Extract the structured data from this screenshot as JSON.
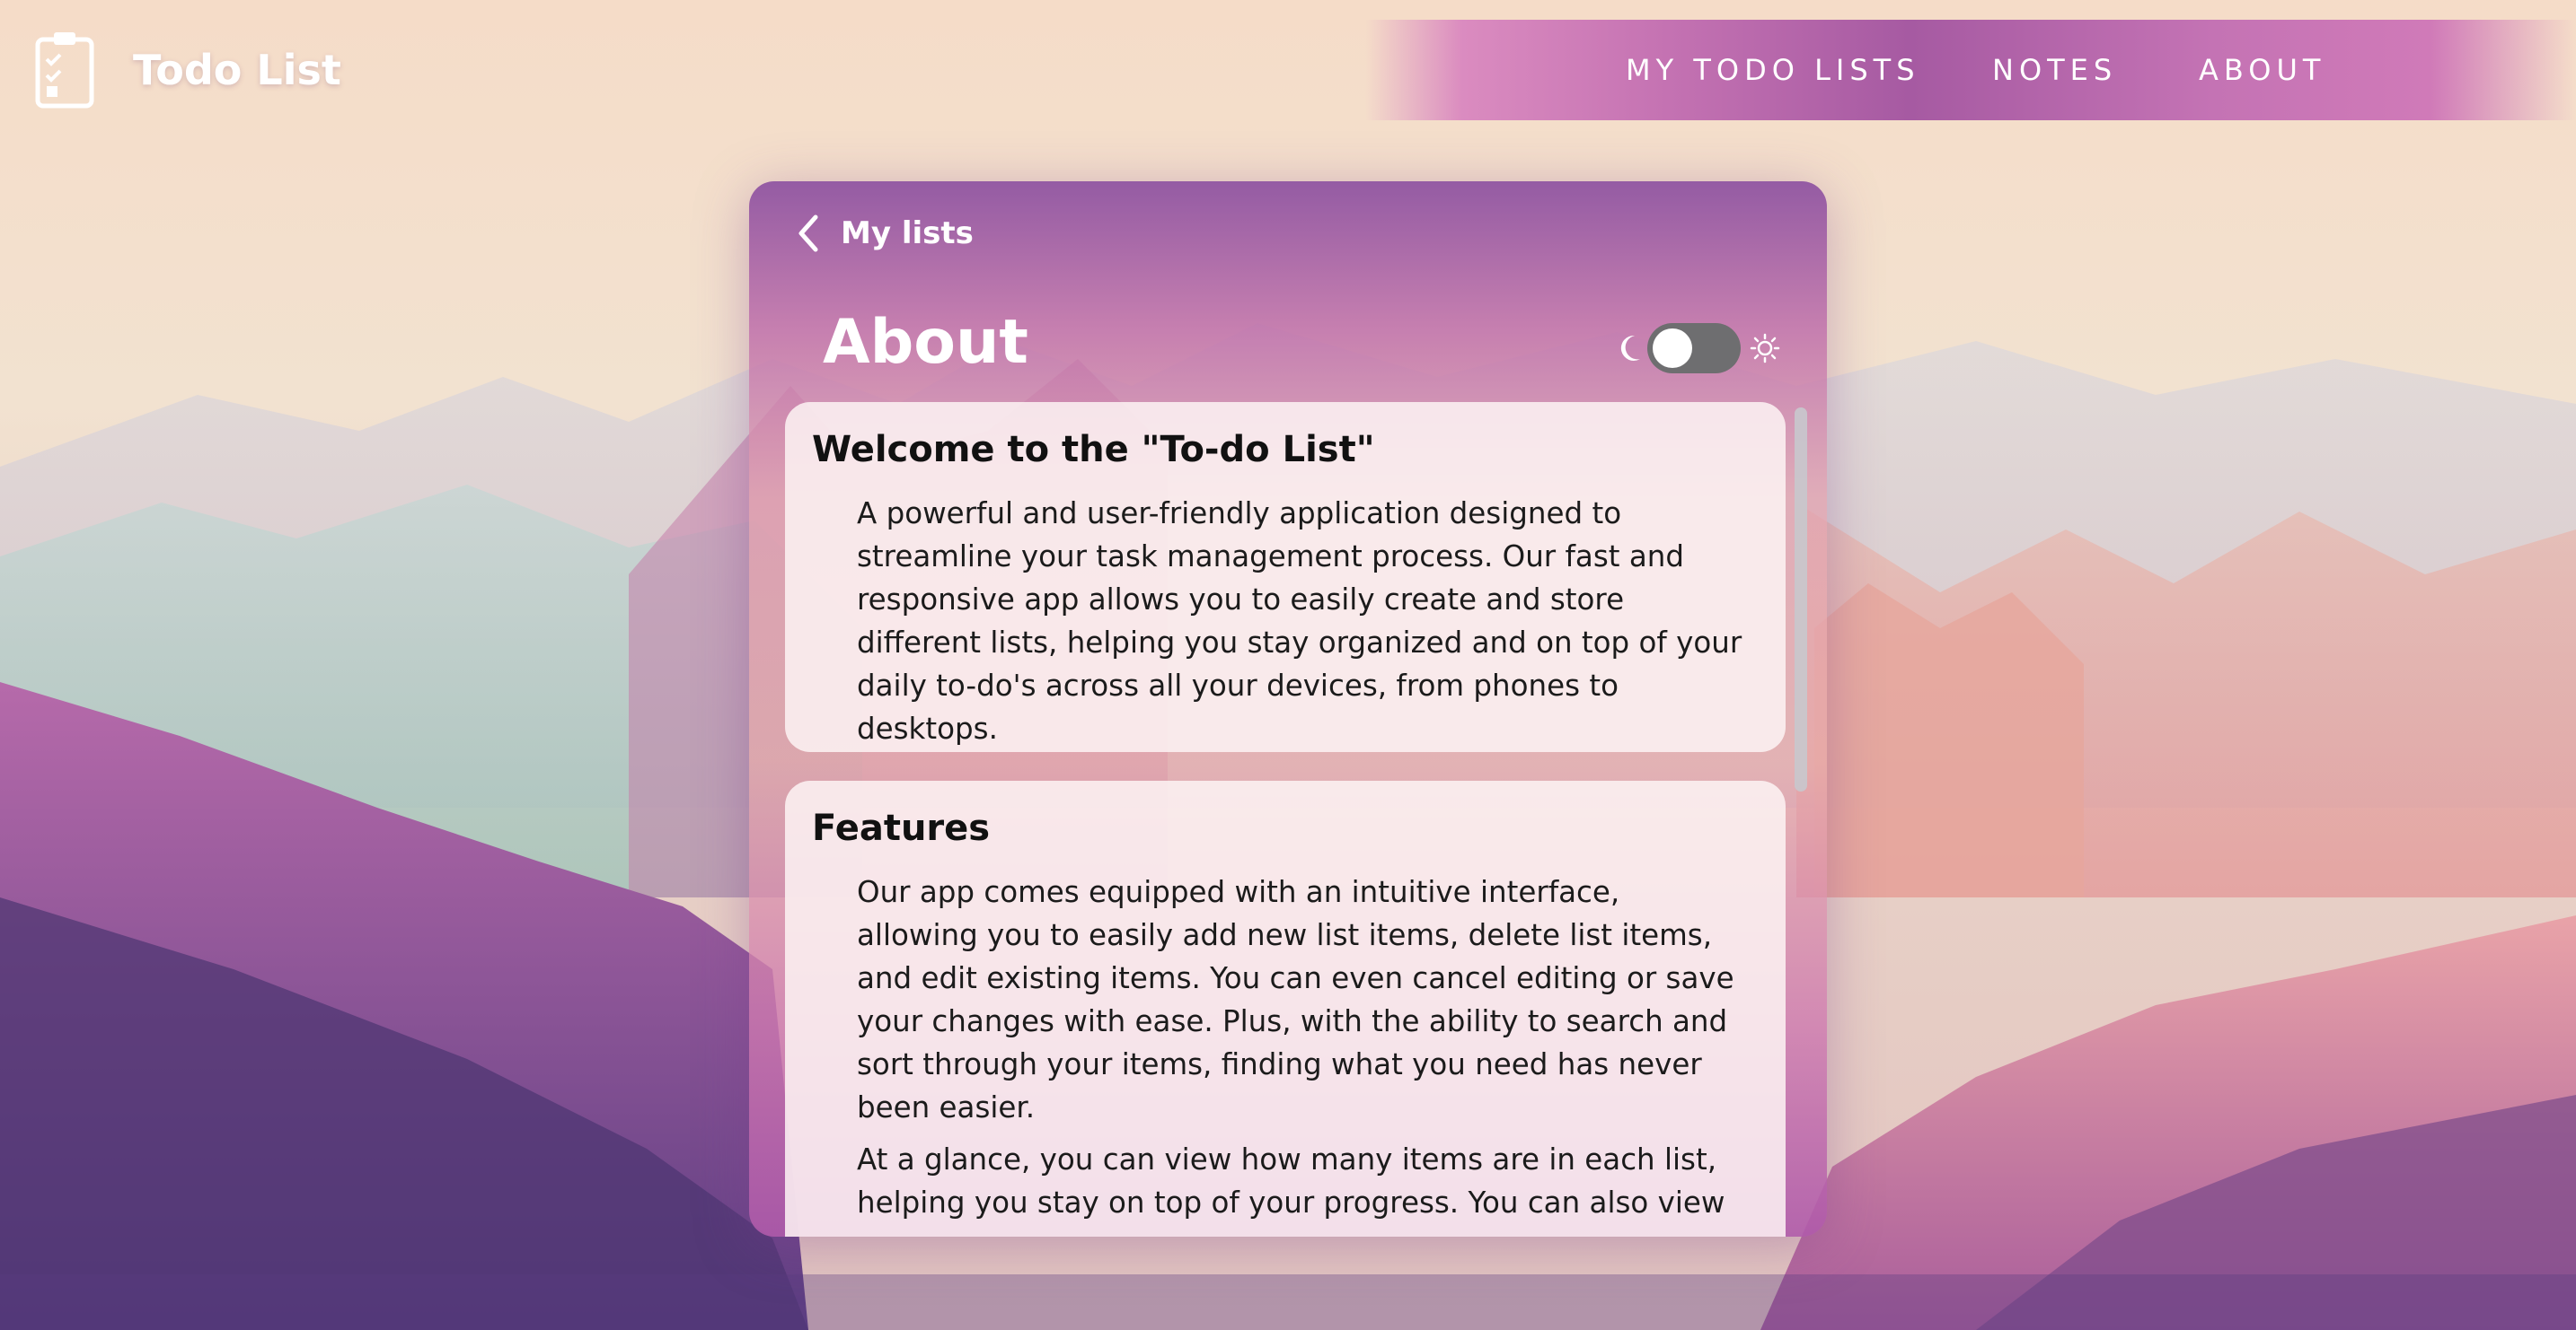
{
  "app": {
    "title": "Todo List",
    "icon": "clipboard-checklist-icon"
  },
  "nav": {
    "items": [
      {
        "label": "MY TODO LISTS"
      },
      {
        "label": "NOTES"
      },
      {
        "label": "ABOUT"
      }
    ]
  },
  "panel": {
    "back_label": "My lists",
    "back_icon": "chevron-left-icon",
    "title": "About",
    "theme_toggle": {
      "dark_icon": "moon-icon",
      "light_icon": "sun-icon",
      "state": "dark"
    },
    "sections": [
      {
        "heading": "Welcome to the \"To-do List\"",
        "paragraphs": [
          "A powerful and user-friendly application designed to streamline your task management process. Our fast and responsive app allows you to easily create and store different lists, helping you stay organized and on top of your daily to-do's across all your devices, from phones to desktops."
        ]
      },
      {
        "heading": "Features",
        "paragraphs": [
          "Our app comes equipped with an intuitive interface, allowing you to easily add new list items, delete list items, and edit existing items. You can even cancel editing or save your changes with ease. Plus, with the ability to search and sort through your items, finding what you need has never been easier.",
          "At a glance, you can view how many items are in each list, helping you stay on top of your progress. You can also view"
        ]
      }
    ]
  },
  "colors": {
    "nav_accent": "#a65aa2",
    "panel_top": "#8c50a0",
    "card_background": "#fdf3f3",
    "toggle_track": "#6e6e70"
  }
}
